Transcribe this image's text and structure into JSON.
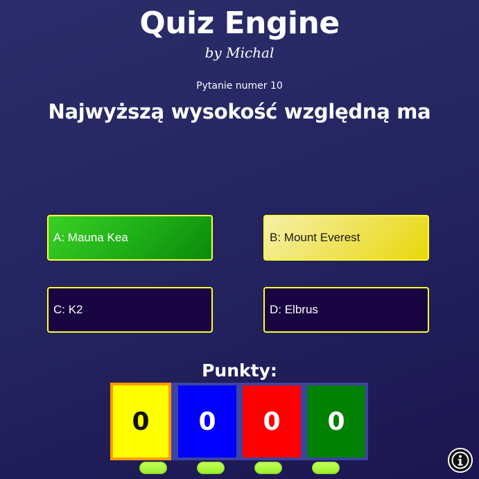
{
  "header": {
    "title": "Quiz Engine",
    "subtitle": "by Michal"
  },
  "question": {
    "number_label": "Pytanie numer 10",
    "text": "Najwyższą wysokość względną ma"
  },
  "answers": [
    {
      "label": "A: Mauna Kea",
      "state": "correct",
      "color": "#1fb018"
    },
    {
      "label": "B: Mount Everest",
      "state": "selected",
      "color": "#efe35a"
    },
    {
      "label": "C: K2",
      "state": "default",
      "color": "#170440"
    },
    {
      "label": "D: Elbrus",
      "state": "default",
      "color": "#170440"
    }
  ],
  "scores": {
    "label": "Punkty:",
    "players": [
      {
        "value": "0",
        "color": "#ffff00"
      },
      {
        "value": "0",
        "color": "#0000ff"
      },
      {
        "value": "0",
        "color": "#ff0000"
      },
      {
        "value": "0",
        "color": "#008000"
      }
    ]
  },
  "info_button": {
    "icon": "info-icon"
  }
}
